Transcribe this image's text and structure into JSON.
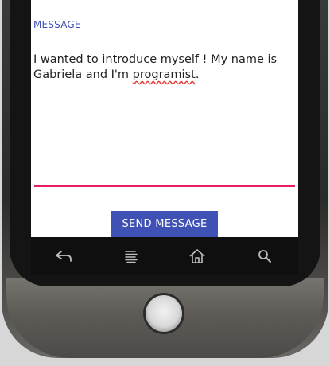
{
  "compose": {
    "field_label": "MESSAGE",
    "message_before": "I wanted to introduce myself ! My name is Gabriela and I'm ",
    "message_misspelled": "programist",
    "message_after": ".",
    "send_label": "SEND MESSAGE"
  },
  "navbar": {
    "icons": [
      "back-icon",
      "menu-icon",
      "home-icon",
      "search-icon"
    ]
  },
  "colors": {
    "accent": "#3f51b5",
    "field_underline": "#e91e63",
    "spellcheck": "#e53935"
  }
}
